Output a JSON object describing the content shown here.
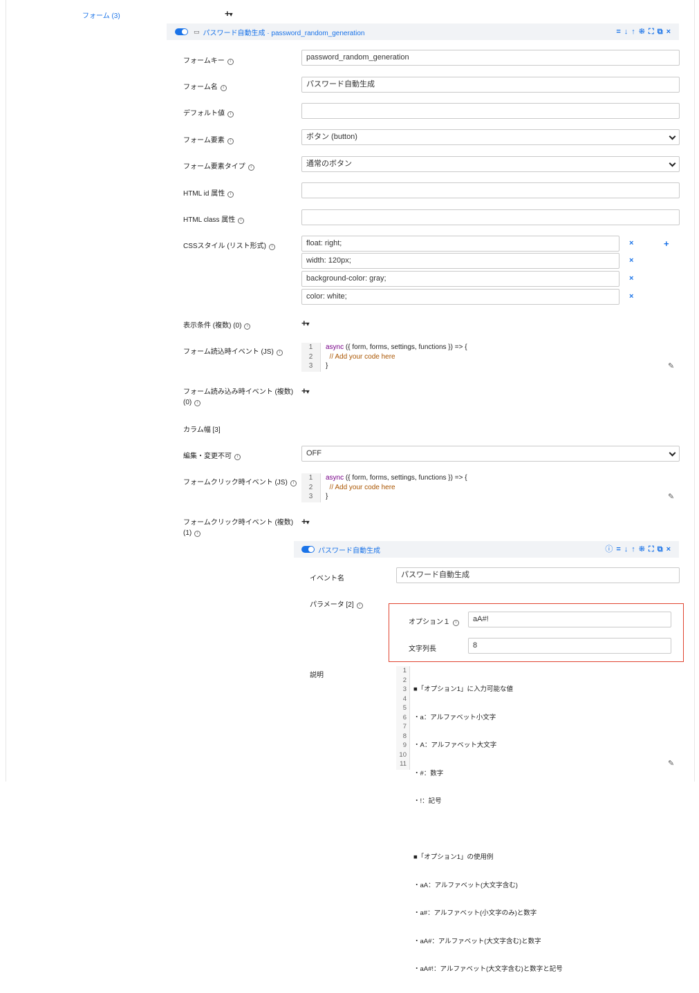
{
  "forms_link": "フォーム (3)",
  "form_header": {
    "title": "パスワード自動生成 · password_random_generation",
    "icons": [
      "=",
      "⬇",
      "⬆",
      "⛶",
      "⛶",
      "⧉",
      "×"
    ]
  },
  "fields": {
    "form_key": {
      "label": "フォームキー",
      "value": "password_random_generation"
    },
    "form_name": {
      "label": "フォーム名",
      "value": "パスワード自動生成"
    },
    "default_value": {
      "label": "デフォルト値",
      "value": ""
    },
    "form_element": {
      "label": "フォーム要素",
      "value": "ボタン (button)"
    },
    "form_element_type": {
      "label": "フォーム要素タイプ",
      "value": "通常のボタン"
    },
    "html_id": {
      "label": "HTML id 属性",
      "value": ""
    },
    "html_class": {
      "label": "HTML class 属性",
      "value": ""
    },
    "css_style": {
      "label": "CSSスタイル (リスト形式)",
      "values": [
        "float: right;",
        "width: 120px;",
        "background-color: gray;",
        "color: white;"
      ]
    },
    "display_conditions": {
      "label": "表示条件 (複数) (0)"
    },
    "load_event_js": {
      "label": "フォーム読込時イベント (JS)"
    },
    "load_events": {
      "label": "フォーム読み込み時イベント (複数)",
      "label2": "(0)"
    },
    "column_width": {
      "label": "カラム幅 [3]"
    },
    "readonly": {
      "label": "編集・変更不可",
      "value": "OFF"
    },
    "click_event_js": {
      "label": "フォームクリック時イベント (JS)"
    },
    "click_events": {
      "label": "フォームクリック時イベント (複数)",
      "label2": "(1)"
    }
  },
  "code_snippet": {
    "line_numbers": [
      "1",
      "2",
      "3"
    ],
    "line1_kw": "async",
    "line1_rest": " ({ form, forms, settings, functions }) => {",
    "line2": "  // Add your code here",
    "line3": "}"
  },
  "event": {
    "header_title": "パスワード自動生成",
    "name_label": "イベント名",
    "name_value": "パスワード自動生成",
    "params_label": "パラメータ [2]",
    "option1_label": "オプション１",
    "option1_value": "aA#!",
    "length_label": "文字列長",
    "length_value": "8",
    "desc_label": "説明",
    "desc_line_numbers": [
      "1",
      "2",
      "3",
      "4",
      "5",
      "6",
      "7",
      "8",
      "9",
      "10",
      "11"
    ],
    "desc_lines": [
      "■「オプション1」に入力可能な値",
      "・a：アルファベット小文字",
      "・A：アルファベット大文字",
      "・#：数字",
      "・!：記号",
      "",
      "■「オプション1」の使用例",
      "・aA：アルファベット(大文字含む)",
      "・a#：アルファベット(小文字のみ)と数字",
      "・aA#：アルファベット(大文字含む)と数字",
      "・aA#!：アルファベット(大文字含む)と数字と記号"
    ]
  },
  "colors": {
    "accent": "#1a73e8",
    "highlight_border": "#e0432f"
  }
}
